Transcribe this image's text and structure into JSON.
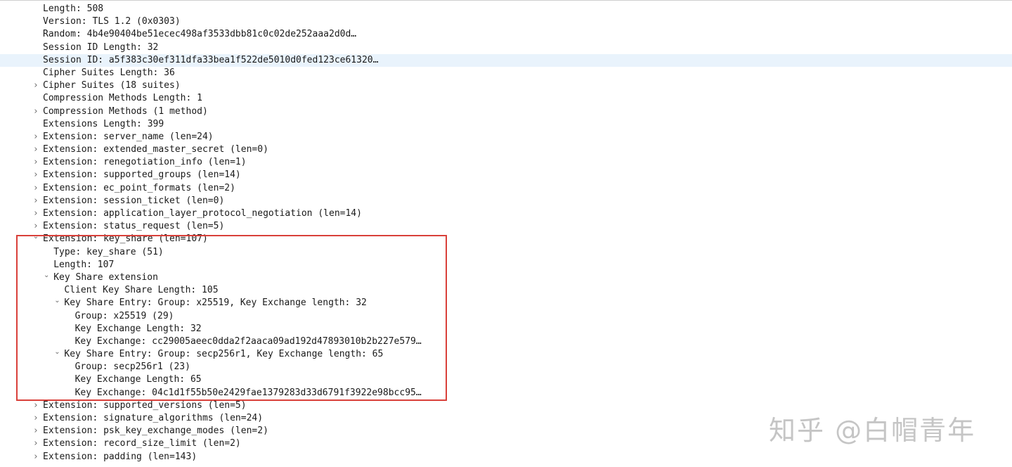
{
  "tree": {
    "rows": [
      {
        "text": "Length: 508",
        "level": 0,
        "expander": "none",
        "selected": false
      },
      {
        "text": "Version: TLS 1.2 (0x0303)",
        "level": 0,
        "expander": "none",
        "selected": false
      },
      {
        "text": "Random: 4b4e90404be51ecec498af3533dbb81c0c02de252aaa2d0d…",
        "level": 0,
        "expander": "none",
        "selected": false
      },
      {
        "text": "Session ID Length: 32",
        "level": 0,
        "expander": "none",
        "selected": false
      },
      {
        "text": "Session ID: a5f383c30ef311dfa33bea1f522de5010d0fed123ce61320…",
        "level": 0,
        "expander": "none",
        "selected": true
      },
      {
        "text": "Cipher Suites Length: 36",
        "level": 0,
        "expander": "none",
        "selected": false
      },
      {
        "text": "Cipher Suites (18 suites)",
        "level": 0,
        "expander": "collapsed",
        "selected": false
      },
      {
        "text": "Compression Methods Length: 1",
        "level": 0,
        "expander": "none",
        "selected": false
      },
      {
        "text": "Compression Methods (1 method)",
        "level": 0,
        "expander": "collapsed",
        "selected": false
      },
      {
        "text": "Extensions Length: 399",
        "level": 0,
        "expander": "none",
        "selected": false
      },
      {
        "text": "Extension: server_name (len=24)",
        "level": 0,
        "expander": "collapsed",
        "selected": false
      },
      {
        "text": "Extension: extended_master_secret (len=0)",
        "level": 0,
        "expander": "collapsed",
        "selected": false
      },
      {
        "text": "Extension: renegotiation_info (len=1)",
        "level": 0,
        "expander": "collapsed",
        "selected": false
      },
      {
        "text": "Extension: supported_groups (len=14)",
        "level": 0,
        "expander": "collapsed",
        "selected": false
      },
      {
        "text": "Extension: ec_point_formats (len=2)",
        "level": 0,
        "expander": "collapsed",
        "selected": false
      },
      {
        "text": "Extension: session_ticket (len=0)",
        "level": 0,
        "expander": "collapsed",
        "selected": false
      },
      {
        "text": "Extension: application_layer_protocol_negotiation (len=14)",
        "level": 0,
        "expander": "collapsed",
        "selected": false
      },
      {
        "text": "Extension: status_request (len=5)",
        "level": 0,
        "expander": "collapsed",
        "selected": false
      },
      {
        "text": "Extension: key_share (len=107)",
        "level": 0,
        "expander": "expanded",
        "selected": false
      },
      {
        "text": "Type: key_share (51)",
        "level": 1,
        "expander": "none",
        "selected": false
      },
      {
        "text": "Length: 107",
        "level": 1,
        "expander": "none",
        "selected": false
      },
      {
        "text": "Key Share extension",
        "level": 1,
        "expander": "expanded",
        "selected": false
      },
      {
        "text": "Client Key Share Length: 105",
        "level": 2,
        "expander": "none",
        "selected": false
      },
      {
        "text": "Key Share Entry: Group: x25519, Key Exchange length: 32",
        "level": 2,
        "expander": "expanded",
        "selected": false
      },
      {
        "text": "Group: x25519 (29)",
        "level": 3,
        "expander": "none",
        "selected": false
      },
      {
        "text": "Key Exchange Length: 32",
        "level": 3,
        "expander": "none",
        "selected": false
      },
      {
        "text": "Key Exchange: cc29005aeec0dda2f2aaca09ad192d47893010b2b227e579…",
        "level": 3,
        "expander": "none",
        "selected": false
      },
      {
        "text": "Key Share Entry: Group: secp256r1, Key Exchange length: 65",
        "level": 2,
        "expander": "expanded",
        "selected": false
      },
      {
        "text": "Group: secp256r1 (23)",
        "level": 3,
        "expander": "none",
        "selected": false
      },
      {
        "text": "Key Exchange Length: 65",
        "level": 3,
        "expander": "none",
        "selected": false
      },
      {
        "text": "Key Exchange: 04c1d1f55b50e2429fae1379283d33d6791f3922e98bcc95…",
        "level": 3,
        "expander": "none",
        "selected": false
      },
      {
        "text": "Extension: supported_versions (len=5)",
        "level": 0,
        "expander": "collapsed",
        "selected": false
      },
      {
        "text": "Extension: signature_algorithms (len=24)",
        "level": 0,
        "expander": "collapsed",
        "selected": false
      },
      {
        "text": "Extension: psk_key_exchange_modes (len=2)",
        "level": 0,
        "expander": "collapsed",
        "selected": false
      },
      {
        "text": "Extension: record_size_limit (len=2)",
        "level": 0,
        "expander": "collapsed",
        "selected": false
      },
      {
        "text": "Extension: padding (len=143)",
        "level": 0,
        "expander": "collapsed",
        "selected": false
      }
    ]
  },
  "icons": {
    "collapsed": "chevron-right-icon",
    "expanded": "chevron-down-icon"
  },
  "colors": {
    "selected_row": "#e9f3fc",
    "highlight_border": "#d9403a",
    "text": "#1a1a1a",
    "watermark": "#969696"
  },
  "watermark": {
    "text": "知乎 @白帽青年"
  }
}
